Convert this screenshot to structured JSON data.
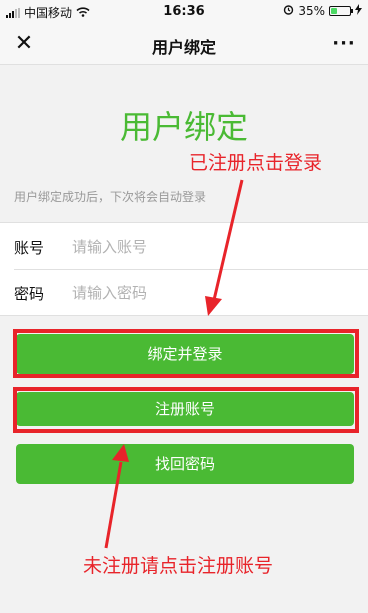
{
  "status_bar": {
    "carrier": "中国移动",
    "time": "16:36",
    "battery_percent_label": "35%",
    "battery_level": 0.35,
    "icons": [
      "signal-icon",
      "wifi-icon",
      "alarm-icon",
      "battery-icon",
      "charging-icon"
    ]
  },
  "nav": {
    "close": "✕",
    "title": "用户绑定",
    "more": "···"
  },
  "page": {
    "heading": "用户绑定",
    "subtitle": "用户绑定成功后，下次将会自动登录"
  },
  "form": {
    "account_label": "账号",
    "account_placeholder": "请输入账号",
    "account_value": "",
    "password_label": "密码",
    "password_placeholder": "请输入密码",
    "password_value": ""
  },
  "buttons": {
    "bind_login": "绑定并登录",
    "register": "注册账号",
    "recover": "找回密码"
  },
  "annotations": {
    "registered": "已注册点击登录",
    "unregistered": "未注册请点击注册账号"
  },
  "colors": {
    "primary_green": "#4aba34",
    "annotation_red": "#e8242a",
    "background": "#f2f2f2"
  }
}
